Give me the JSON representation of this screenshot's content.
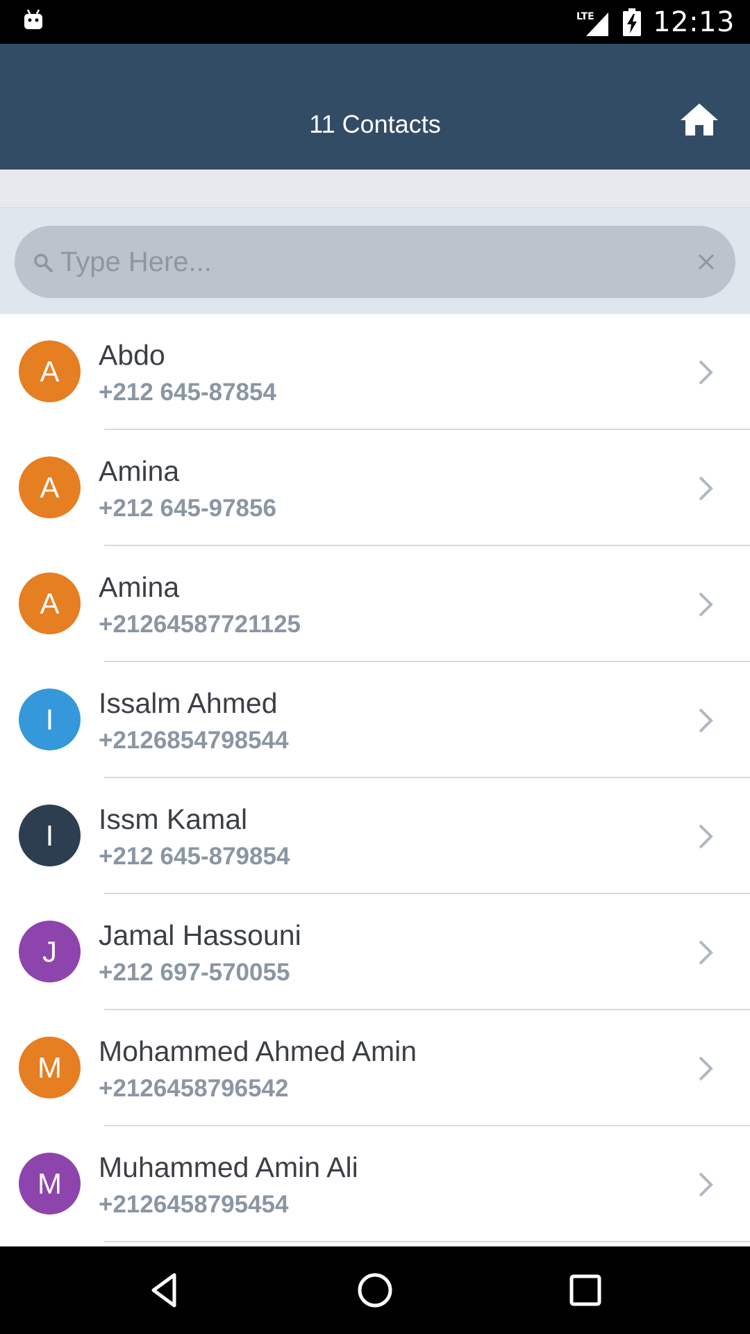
{
  "status_bar": {
    "time": "12:13",
    "network": "LTE",
    "icons": [
      "android-debug-icon",
      "lte-signal-icon",
      "battery-charging-icon"
    ]
  },
  "header": {
    "title": "11 Contacts",
    "home_icon": "home-icon",
    "background": "#334c66"
  },
  "search": {
    "placeholder": "Type Here...",
    "value": "",
    "icon": "search-icon",
    "clear_icon": "close-icon"
  },
  "contacts": [
    {
      "initial": "A",
      "name": "Abdo",
      "phone": "+212 645-87854",
      "color": "#e67e22"
    },
    {
      "initial": "A",
      "name": "Amina",
      "phone": "+212 645-97856",
      "color": "#e67e22"
    },
    {
      "initial": "A",
      "name": "Amina",
      "phone": "+21264587721125",
      "color": "#e67e22"
    },
    {
      "initial": "I",
      "name": "Issalm  Ahmed",
      "phone": "+2126854798544",
      "color": "#3498db"
    },
    {
      "initial": "I",
      "name": "Issm  Kamal",
      "phone": "+212 645-879854",
      "color": "#2c3e50"
    },
    {
      "initial": "J",
      "name": "Jamal  Hassouni",
      "phone": "+212 697-570055",
      "color": "#8e44ad"
    },
    {
      "initial": "M",
      "name": "Mohammed Ahmed Amin",
      "phone": "+2126458796542",
      "color": "#e67e22"
    },
    {
      "initial": "M",
      "name": "Muhammed Amin Ali",
      "phone": "+2126458795454",
      "color": "#8e44ad"
    }
  ],
  "nav_bar": {
    "icons": [
      "back-icon",
      "home-circle-icon",
      "recents-icon"
    ]
  }
}
